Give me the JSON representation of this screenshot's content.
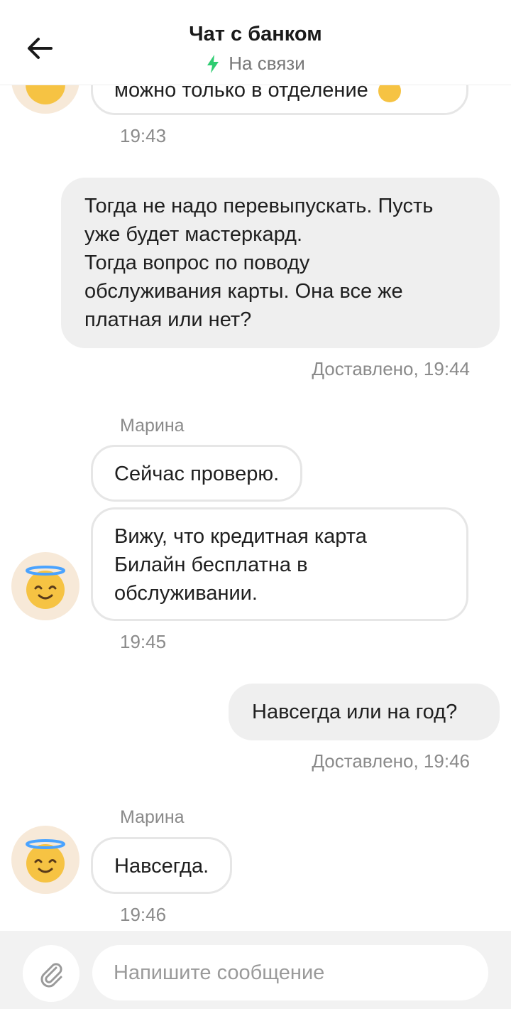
{
  "header": {
    "title": "Чат с банком",
    "status": "На связи",
    "status_color": "#2ecc71"
  },
  "messages": {
    "m0_text": "можно только в отделение",
    "m0_time": "19:43",
    "m1_lines": [
      "Тогда не надо перевыпускать. Пусть",
      "уже будет мастеркард.",
      "Тогда вопрос по поводу",
      "обслуживания карты. Она все же",
      "платная или нет?"
    ],
    "m1_status": "Доставлено, 19:44",
    "sender_1": "Марина",
    "m2_text": "Сейчас проверю.",
    "m3_lines": [
      "Вижу, что кредитная карта",
      "Билайн бесплатна в",
      "обслуживании."
    ],
    "m3_time": "19:45",
    "m4_text": "Навсегда или на год?",
    "m4_status": "Доставлено, 19:46",
    "sender_2": "Марина",
    "m5_text": "Навсегда.",
    "m5_time": "19:46"
  },
  "composer": {
    "placeholder": "Напишите сообщение"
  },
  "icons": {
    "back": "arrow-left-icon",
    "status": "lightning-icon",
    "attach": "paperclip-icon",
    "avatar": "angel-emoji-icon"
  }
}
